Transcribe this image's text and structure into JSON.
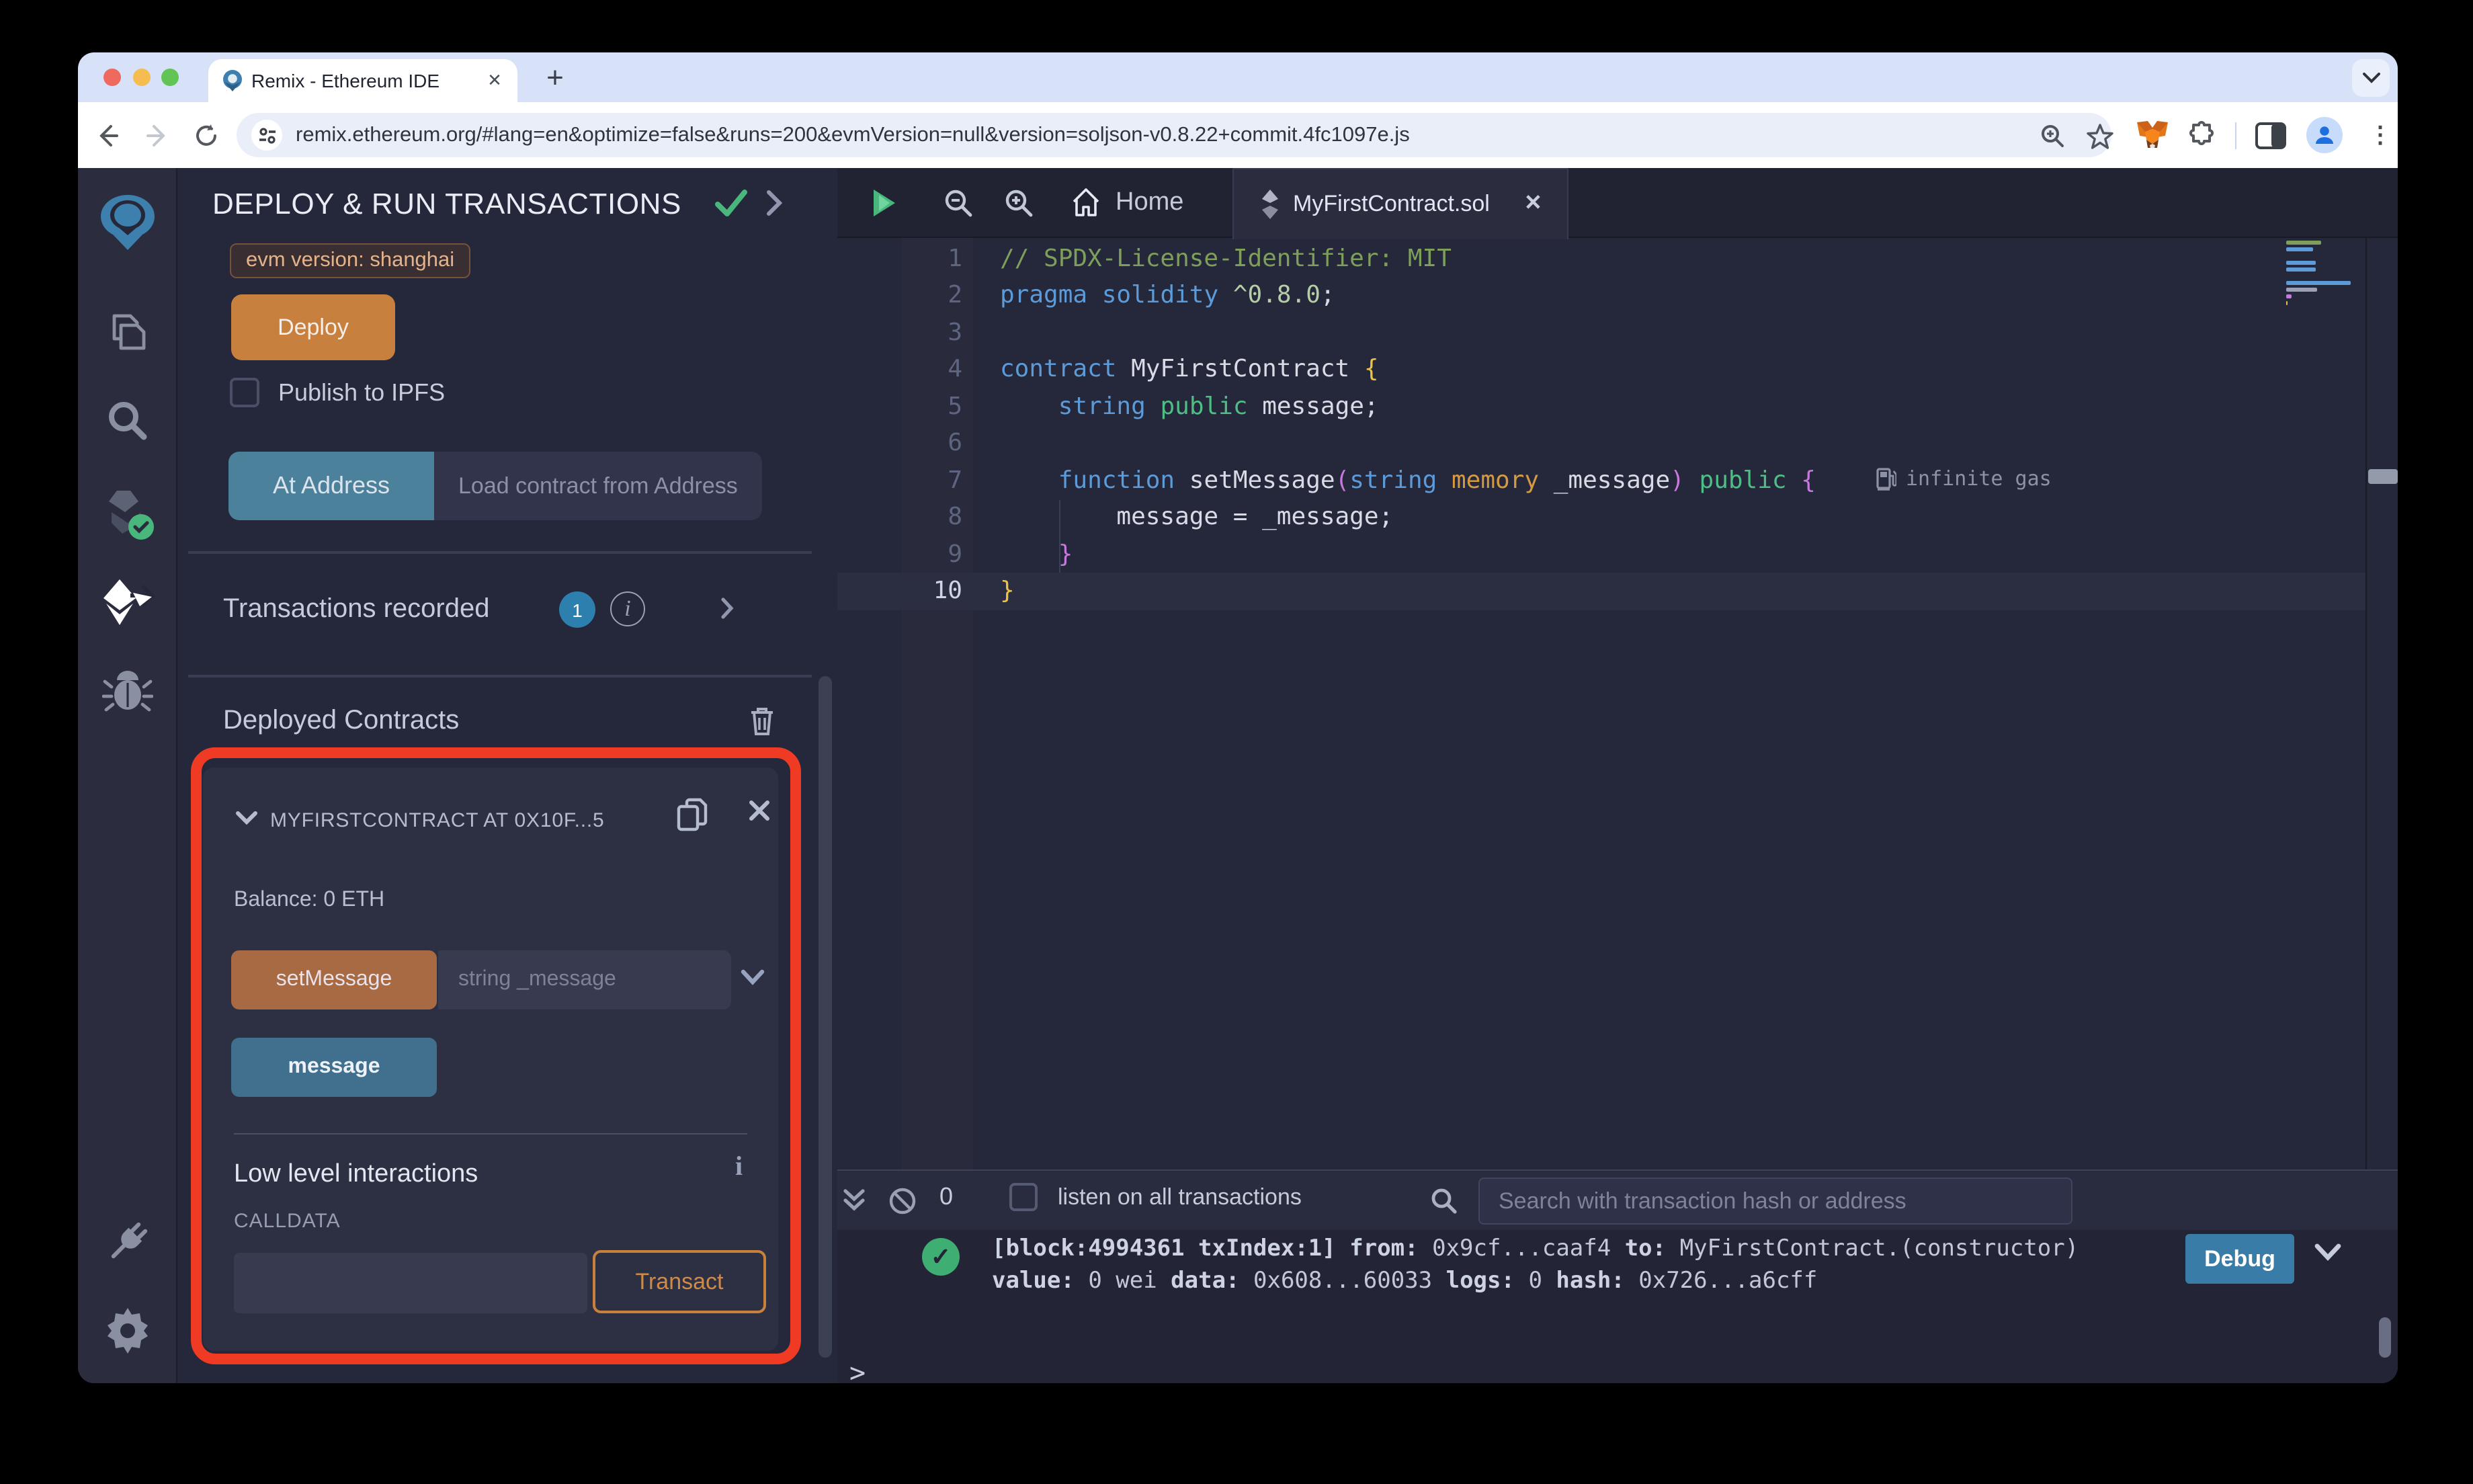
{
  "browser": {
    "tab_title": "Remix - Ethereum IDE",
    "new_tab": "+",
    "url": "remix.ethereum.org/#lang=en&optimize=false&runs=200&evmVersion=null&version=soljson-v0.8.22+commit.4fc1097e.js"
  },
  "activity_bar": {
    "items": [
      "remix-logo",
      "file-explorer",
      "search",
      "solidity-compiler",
      "deploy-and-run",
      "debugger",
      "plugin-manager",
      "settings"
    ]
  },
  "panel": {
    "title": "DEPLOY & RUN TRANSACTIONS",
    "evm_badge": "evm version: shanghai",
    "deploy_button": "Deploy",
    "publish_label": "Publish to IPFS",
    "at_address_button": "At Address",
    "at_address_placeholder": "Load contract from Address",
    "transactions_recorded": {
      "label": "Transactions recorded",
      "count": "1"
    },
    "deployed_contracts_label": "Deployed Contracts",
    "contract": {
      "title": "MYFIRSTCONTRACT AT 0X10F...5",
      "balance": "Balance: 0 ETH",
      "set_message_button": "setMessage",
      "set_message_placeholder": "string _message",
      "message_button": "message",
      "low_level_label": "Low level interactions",
      "low_level_info": "i",
      "calldata_label": "CALLDATA",
      "transact_button": "Transact"
    }
  },
  "editor": {
    "home_tab": "Home",
    "file_tab": "MyFirstContract.sol",
    "gas_annotation": "infinite gas",
    "lines": [
      {
        "n": "1",
        "tokens": [
          [
            "comment",
            "// SPDX-License-Identifier: MIT"
          ]
        ]
      },
      {
        "n": "2",
        "tokens": [
          [
            "kw",
            "pragma"
          ],
          [
            "plain",
            " "
          ],
          [
            "kw",
            "solidity"
          ],
          [
            "plain",
            " "
          ],
          [
            "pale",
            "^0.8.0"
          ],
          [
            "plain",
            ";"
          ]
        ]
      },
      {
        "n": "3",
        "tokens": []
      },
      {
        "n": "4",
        "tokens": [
          [
            "kw",
            "contract"
          ],
          [
            "plain",
            " MyFirstContract "
          ],
          [
            "gold",
            "{"
          ]
        ]
      },
      {
        "n": "5",
        "tokens": [
          [
            "plain",
            "    "
          ],
          [
            "kw",
            "string"
          ],
          [
            "plain",
            " "
          ],
          [
            "green",
            "public"
          ],
          [
            "plain",
            " message;"
          ]
        ]
      },
      {
        "n": "6",
        "tokens": []
      },
      {
        "n": "7",
        "tokens": [
          [
            "plain",
            "    "
          ],
          [
            "kw",
            "function"
          ],
          [
            "plain",
            " setMessage"
          ],
          [
            "magenta",
            "("
          ],
          [
            "kw",
            "string"
          ],
          [
            "plain",
            " "
          ],
          [
            "kw2",
            "memory"
          ],
          [
            "plain",
            " _message"
          ],
          [
            "magenta",
            ")"
          ],
          [
            "plain",
            " "
          ],
          [
            "green",
            "public"
          ],
          [
            "plain",
            " "
          ],
          [
            "magenta",
            "{"
          ]
        ],
        "gas": true
      },
      {
        "n": "8",
        "tokens": [
          [
            "plain",
            "        message = _message;"
          ]
        ]
      },
      {
        "n": "9",
        "tokens": [
          [
            "plain",
            "    "
          ],
          [
            "magenta",
            "}"
          ]
        ]
      },
      {
        "n": "10",
        "tokens": [
          [
            "gold",
            "}"
          ]
        ],
        "current": true
      }
    ]
  },
  "terminal": {
    "count": "0",
    "listen_label": "listen on all transactions",
    "search_placeholder": "Search with transaction hash or address",
    "log_line1": [
      [
        "b",
        "[block:4994361 txIndex:1]"
      ],
      [
        "r",
        " "
      ],
      [
        "b",
        "from:"
      ],
      [
        "r",
        " 0x9cf...caaf4 "
      ],
      [
        "b",
        "to:"
      ],
      [
        "r",
        " MyFirstContract.(constructor)"
      ]
    ],
    "log_line2": [
      [
        "b",
        "value:"
      ],
      [
        "r",
        " 0 wei "
      ],
      [
        "b",
        "data:"
      ],
      [
        "r",
        " 0x608...60033 "
      ],
      [
        "b",
        "logs:"
      ],
      [
        "r",
        " 0 "
      ],
      [
        "b",
        "hash:"
      ],
      [
        "r",
        " 0x726...a6cff"
      ]
    ],
    "debug_button": "Debug",
    "prompt": ">"
  },
  "colors": {
    "accent_orange": "#c8803e",
    "muted_orange": "#a86a42",
    "accent_teal": "#4c819c",
    "steel_blue": "#41708e",
    "highlight_red": "#ef3b24",
    "success_green": "#3fae73",
    "count_badge_blue": "#2d7fae",
    "debug_blue": "#3a7ca8",
    "evm_badge_text": "#e5b38b"
  }
}
